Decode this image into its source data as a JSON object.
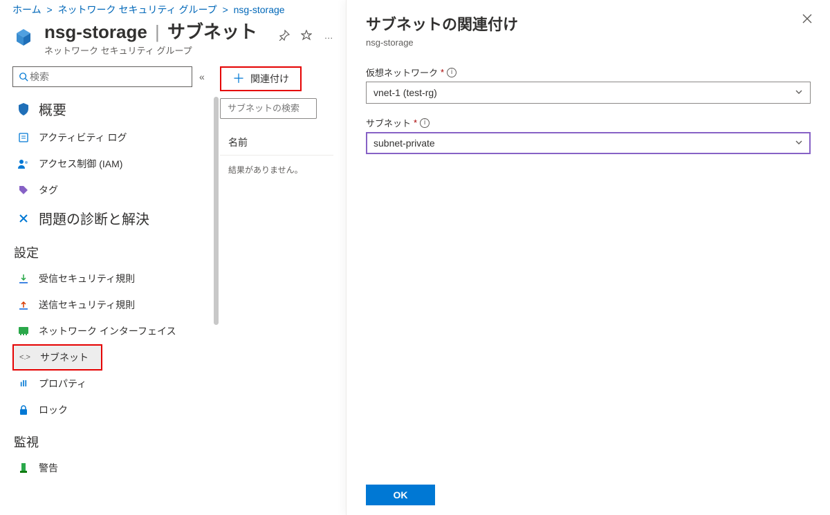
{
  "breadcrumb": {
    "home": "ホーム",
    "group": "ネットワーク セキュリティ グループ",
    "current": "nsg-storage"
  },
  "header": {
    "title_name": "nsg-storage",
    "title_section": "サブネット",
    "subtitle": "ネットワーク セキュリティ グループ",
    "more": "…"
  },
  "sidebar": {
    "search_placeholder": "検索",
    "collapse": "«",
    "items_top": [
      {
        "icon": "shield",
        "label": "概要",
        "big": true
      },
      {
        "icon": "log",
        "label": "アクティビティ ログ"
      },
      {
        "icon": "iam",
        "label": "アクセス制御 (IAM)"
      },
      {
        "icon": "tag",
        "label": "タグ"
      },
      {
        "icon": "diagnose",
        "label": "問題の診断と解決",
        "big": true
      }
    ],
    "section_settings": "設定",
    "items_settings": [
      {
        "icon": "in",
        "label": "受信セキュリティ規則"
      },
      {
        "icon": "out",
        "label": "送信セキュリティ規則"
      },
      {
        "icon": "nic",
        "label": "ネットワーク インターフェイス"
      },
      {
        "icon": "sub",
        "label": "サブネット",
        "selected": true
      },
      {
        "icon": "prop",
        "label": "プロパティ"
      },
      {
        "icon": "lock",
        "label": "ロック"
      }
    ],
    "section_monitor": "監視",
    "items_monitor": [
      {
        "icon": "alert",
        "label": "警告"
      }
    ]
  },
  "main": {
    "associate_btn": "関連付け",
    "search_placeholder": "サブネットの検索",
    "col_name": "名前",
    "empty": "結果がありません。"
  },
  "flyout": {
    "title": "サブネットの関連付け",
    "subtitle": "nsg-storage",
    "vnet_label": "仮想ネットワーク",
    "vnet_value": "vnet-1 (test-rg)",
    "subnet_label": "サブネット",
    "subnet_value": "subnet-private",
    "ok": "OK"
  }
}
